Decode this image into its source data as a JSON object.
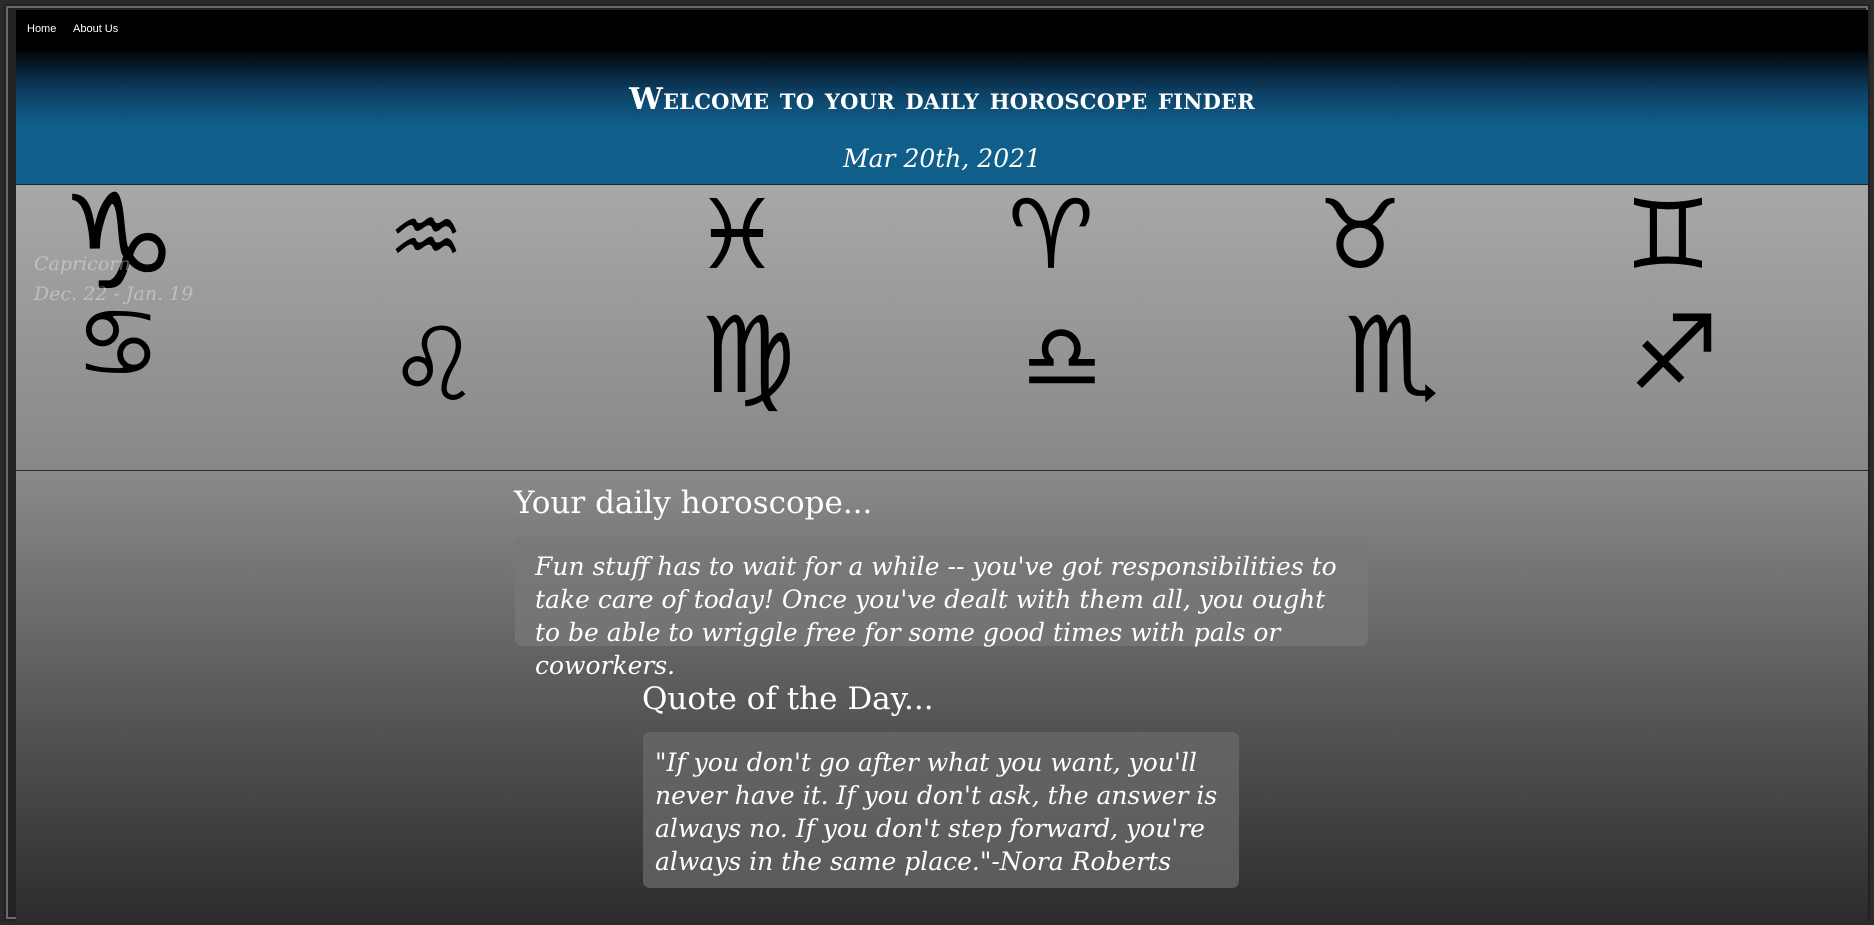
{
  "nav": {
    "home_label": "Home",
    "about_label": "About Us"
  },
  "header": {
    "title": "Welcome to your daily horoscope finder",
    "date": "Mar 20th, 2021"
  },
  "zodiac": {
    "signs": [
      {
        "icon": "capricorn-icon",
        "glyph": "♑"
      },
      {
        "icon": "aquarius-icon",
        "glyph": "♒"
      },
      {
        "icon": "pisces-icon",
        "glyph": "♓"
      },
      {
        "icon": "aries-icon",
        "glyph": "♈"
      },
      {
        "icon": "taurus-icon",
        "glyph": "♉"
      },
      {
        "icon": "gemini-icon",
        "glyph": "♊"
      },
      {
        "icon": "cancer-icon",
        "glyph": "♋"
      },
      {
        "icon": "leo-icon",
        "glyph": "♌"
      },
      {
        "icon": "virgo-icon",
        "glyph": "♍"
      },
      {
        "icon": "libra-icon",
        "glyph": "♎"
      },
      {
        "icon": "scorpio-icon",
        "glyph": "♏"
      },
      {
        "icon": "sagittarius-icon",
        "glyph": "♐"
      }
    ],
    "hover_tooltip": {
      "name": "Capricorn",
      "dates": "Dec. 22 - Jan. 19"
    }
  },
  "horoscope": {
    "heading": "Your daily horoscope...",
    "text": "Fun stuff has to wait for a while -- you've got responsibilities to take care of today! Once you've dealt with them all, you ought to be able to wriggle free for some good times with pals or coworkers."
  },
  "quote": {
    "heading": "Quote of the Day...",
    "text": "\"If you don't go after what you want, you'll never have it. If you don't ask, the answer is always no. If you don't step forward, you're always in the same place.\"-Nora Roberts"
  }
}
